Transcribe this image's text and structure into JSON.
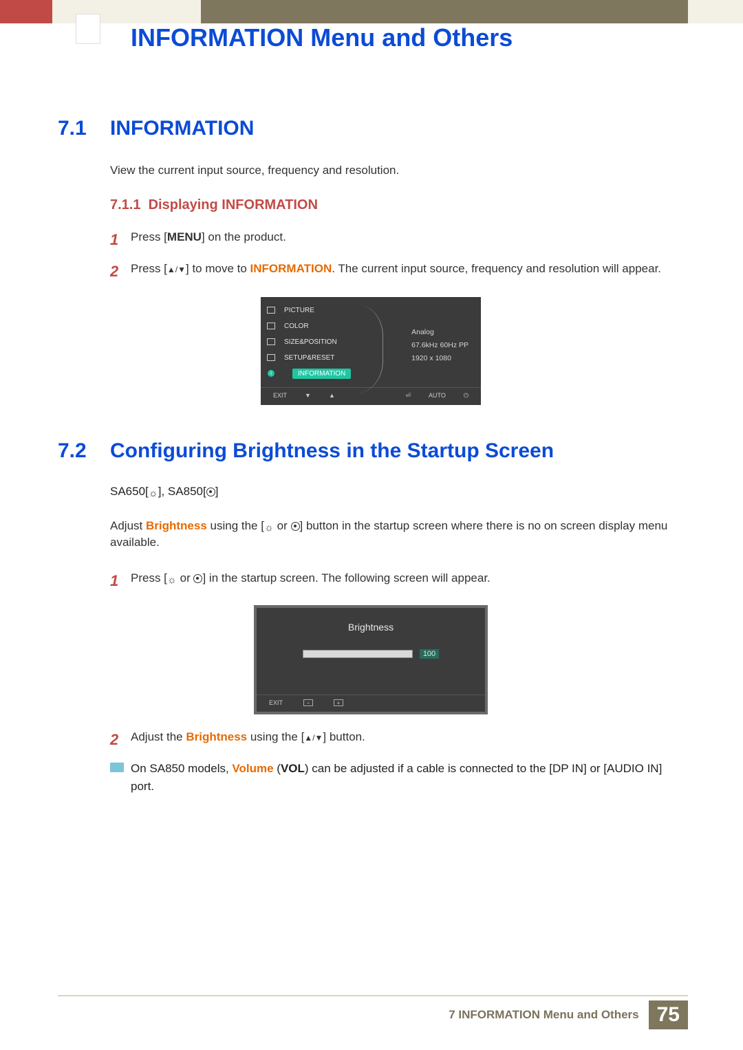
{
  "header": {
    "title": "INFORMATION Menu and Others"
  },
  "section1": {
    "num": "7.1",
    "title": "INFORMATION",
    "intro": "View the current input source, frequency and resolution.",
    "sub": {
      "num": "7.1.1",
      "title": "Displaying INFORMATION"
    },
    "step1_pre": "Press [",
    "step1_btn": "MENU",
    "step1_post": "] on the product.",
    "step2_pre": "Press [",
    "step2_mid": "] to move to ",
    "step2_hl": "INFORMATION",
    "step2_post": ". The current input source, frequency and resolution will appear."
  },
  "osd": {
    "items": [
      "PICTURE",
      "COLOR",
      "SIZE&POSITION",
      "SETUP&RESET"
    ],
    "selected": "INFORMATION",
    "info": {
      "source": "Analog",
      "freq": "67.6kHz 60Hz PP",
      "res": "1920 x 1080"
    },
    "footer": {
      "exit": "EXIT",
      "auto": "AUTO"
    }
  },
  "section2": {
    "num": "7.2",
    "title": "Configuring Brightness in the Startup Screen",
    "models_pre": "SA650[",
    "models_mid": "], SA850[",
    "models_post": "]",
    "desc_pre": "Adjust ",
    "desc_hl": "Brightness",
    "desc_mid": " using the [",
    "desc_or": " or ",
    "desc_post": "] button in the startup screen where there is no on screen display menu available.",
    "step1_pre": "Press [",
    "step1_or": " or ",
    "step1_post": "] in the startup screen. The following screen will appear.",
    "step2_pre": "Adjust the ",
    "step2_hl": "Brightness",
    "step2_mid": " using the [",
    "step2_post": "] button.",
    "note_pre": "On SA850 models, ",
    "note_hl": "Volume",
    "note_mid": " (",
    "note_vol": "VOL",
    "note_post": ") can be adjusted if a cable is connected to the [DP IN] or [AUDIO IN] port."
  },
  "bright_osd": {
    "title": "Brightness",
    "value": "100",
    "exit": "EXIT"
  },
  "footer": {
    "chapter": "7 INFORMATION Menu and Others",
    "page": "75"
  },
  "step_nums": {
    "one": "1",
    "two": "2"
  }
}
